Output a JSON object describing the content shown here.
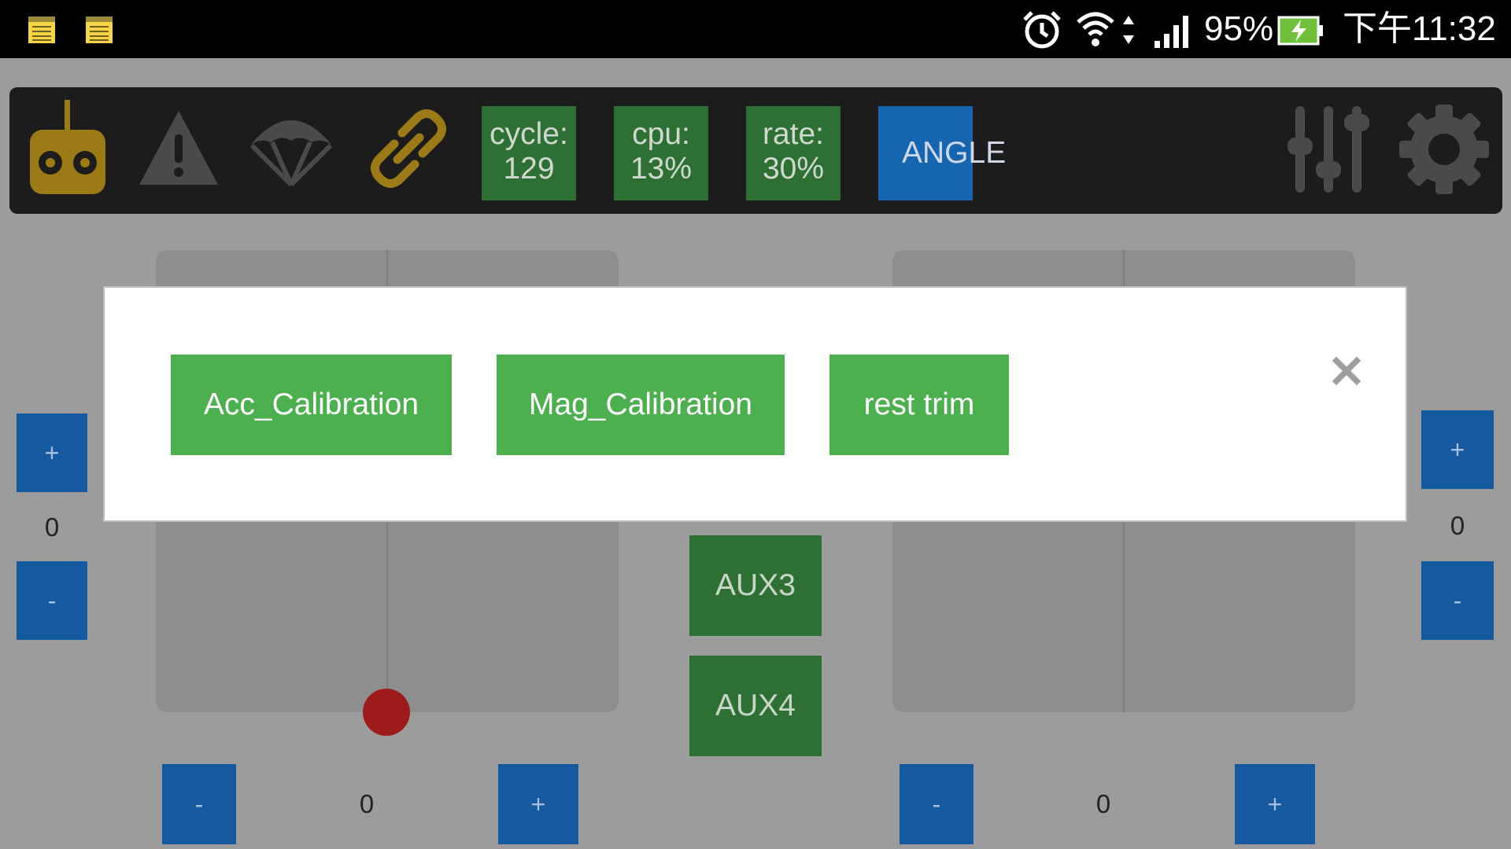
{
  "status_bar": {
    "notification_icons": [
      "notes-icon",
      "notes-icon"
    ],
    "battery_percent": "95%",
    "time": "下午11:32",
    "icons": [
      "alarm-icon",
      "wifi-icon",
      "signal-icon",
      "battery-charging-icon"
    ]
  },
  "toolbar": {
    "icons": [
      "remote-controller-icon",
      "warning-icon",
      "parachute-icon",
      "link-icon",
      "sliders-icon",
      "gear-icon"
    ],
    "stats": [
      {
        "label": "cycle:",
        "value": "129"
      },
      {
        "label": "cpu:",
        "value": "13%"
      },
      {
        "label": "rate:",
        "value": "30%"
      }
    ],
    "mode": "ANGLE",
    "colors": {
      "stat_bg": "#2e6f33",
      "mode_bg": "#1565b0",
      "icon_gold": "#9c7a16",
      "icon_gray": "#4a4a4a"
    }
  },
  "controls": {
    "left_trim_value": "0",
    "right_trim_value": "0",
    "bottom_left_value": "0",
    "bottom_right_value": "0",
    "plus_label": "+",
    "minus_label": "-",
    "aux_buttons": [
      "AUX3",
      "AUX4"
    ]
  },
  "dialog": {
    "buttons": [
      "Acc_Calibration",
      "Mag_Calibration",
      "rest trim"
    ],
    "close_label": "✕"
  }
}
